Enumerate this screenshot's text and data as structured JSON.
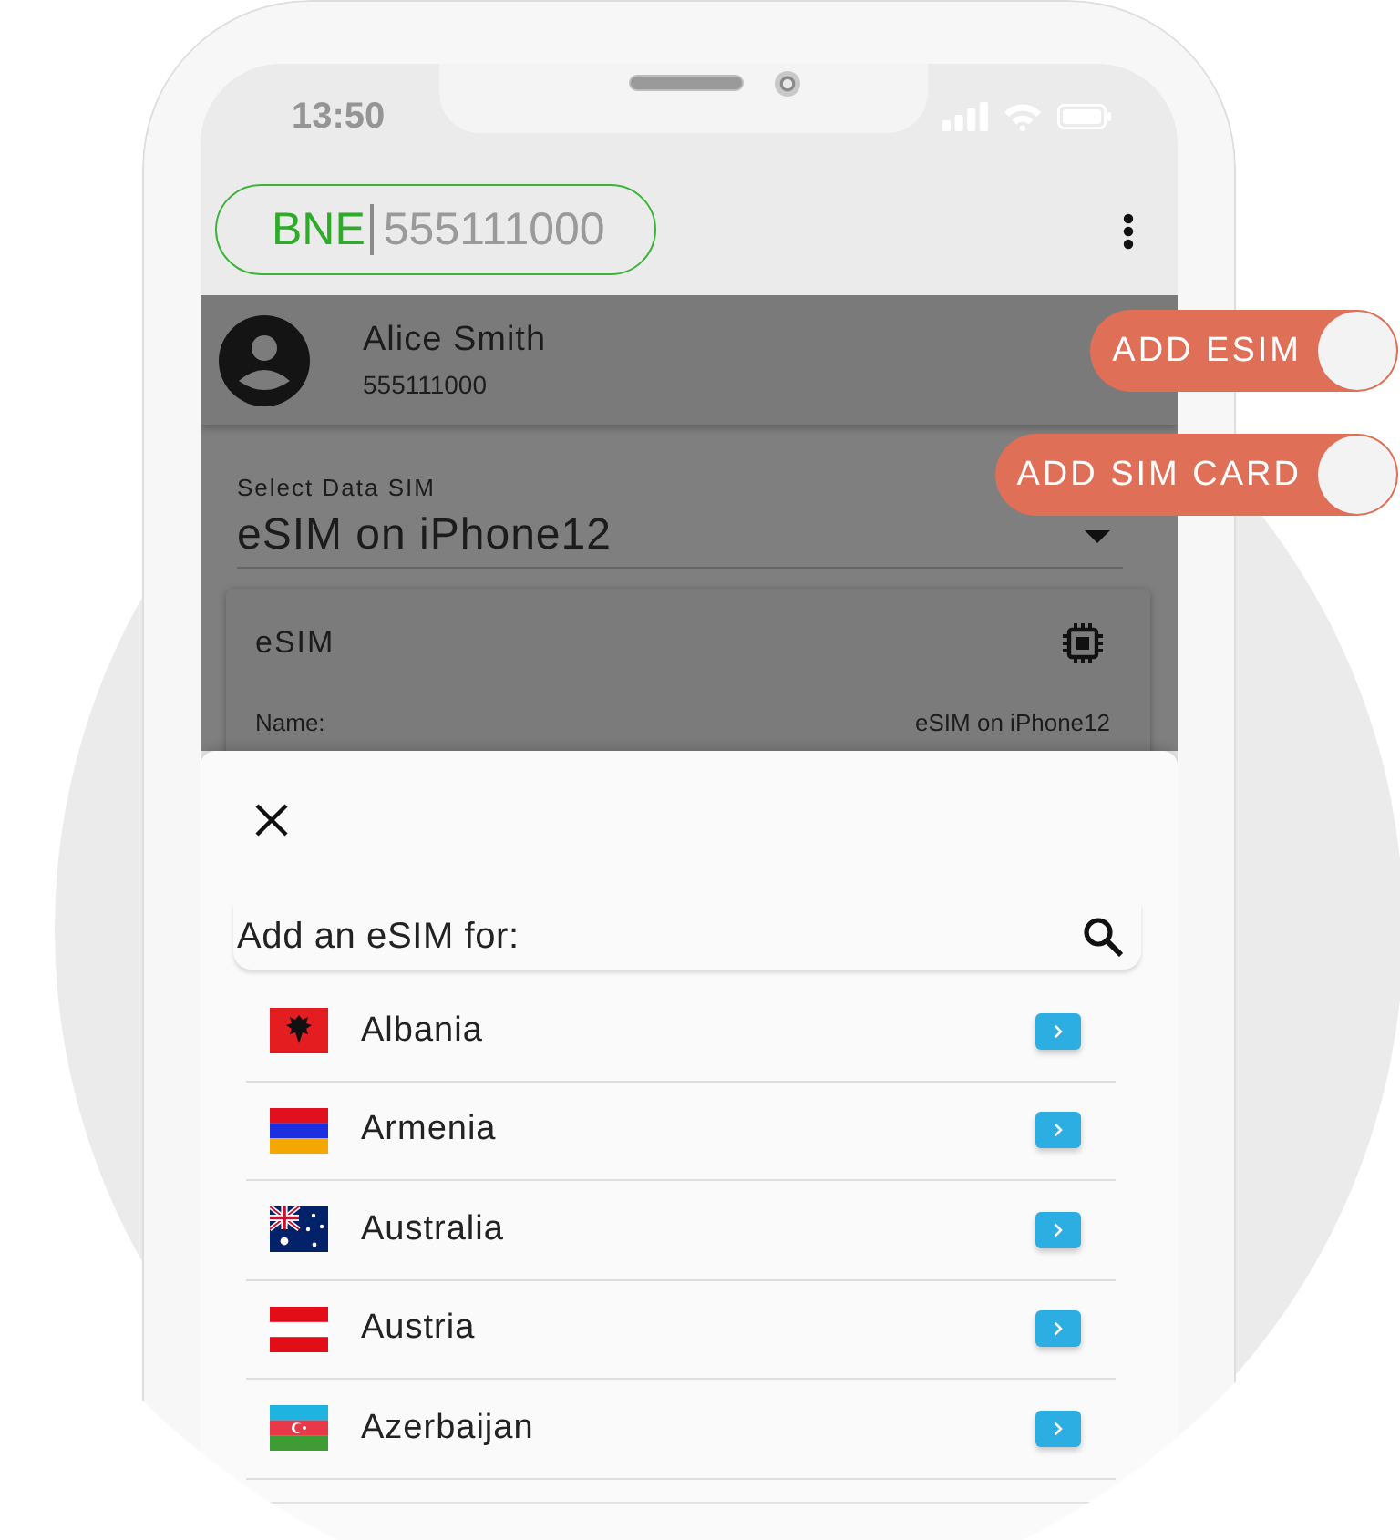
{
  "status_bar": {
    "time": "13:50"
  },
  "header": {
    "brand": "BNE",
    "number": "555111000"
  },
  "account": {
    "name": "Alice Smith",
    "number": "555111000"
  },
  "data_sim": {
    "label": "Select Data SIM",
    "value": "eSIM on iPhone12"
  },
  "sim_card": {
    "title": "eSIM",
    "fields": [
      {
        "label": "Name:",
        "value": "eSIM on iPhone12"
      }
    ]
  },
  "sheet": {
    "title": "Add an eSIM for:",
    "countries": [
      {
        "kind": "albania",
        "name": "Albania"
      },
      {
        "kind": "armenia",
        "name": "Armenia"
      },
      {
        "kind": "australia",
        "name": "Australia"
      },
      {
        "kind": "austria",
        "name": "Austria"
      },
      {
        "kind": "azerbaijan",
        "name": "Azerbaijan"
      }
    ]
  },
  "actions": [
    {
      "label": "ADD ESIM"
    },
    {
      "label": "ADD SIM CARD"
    }
  ]
}
